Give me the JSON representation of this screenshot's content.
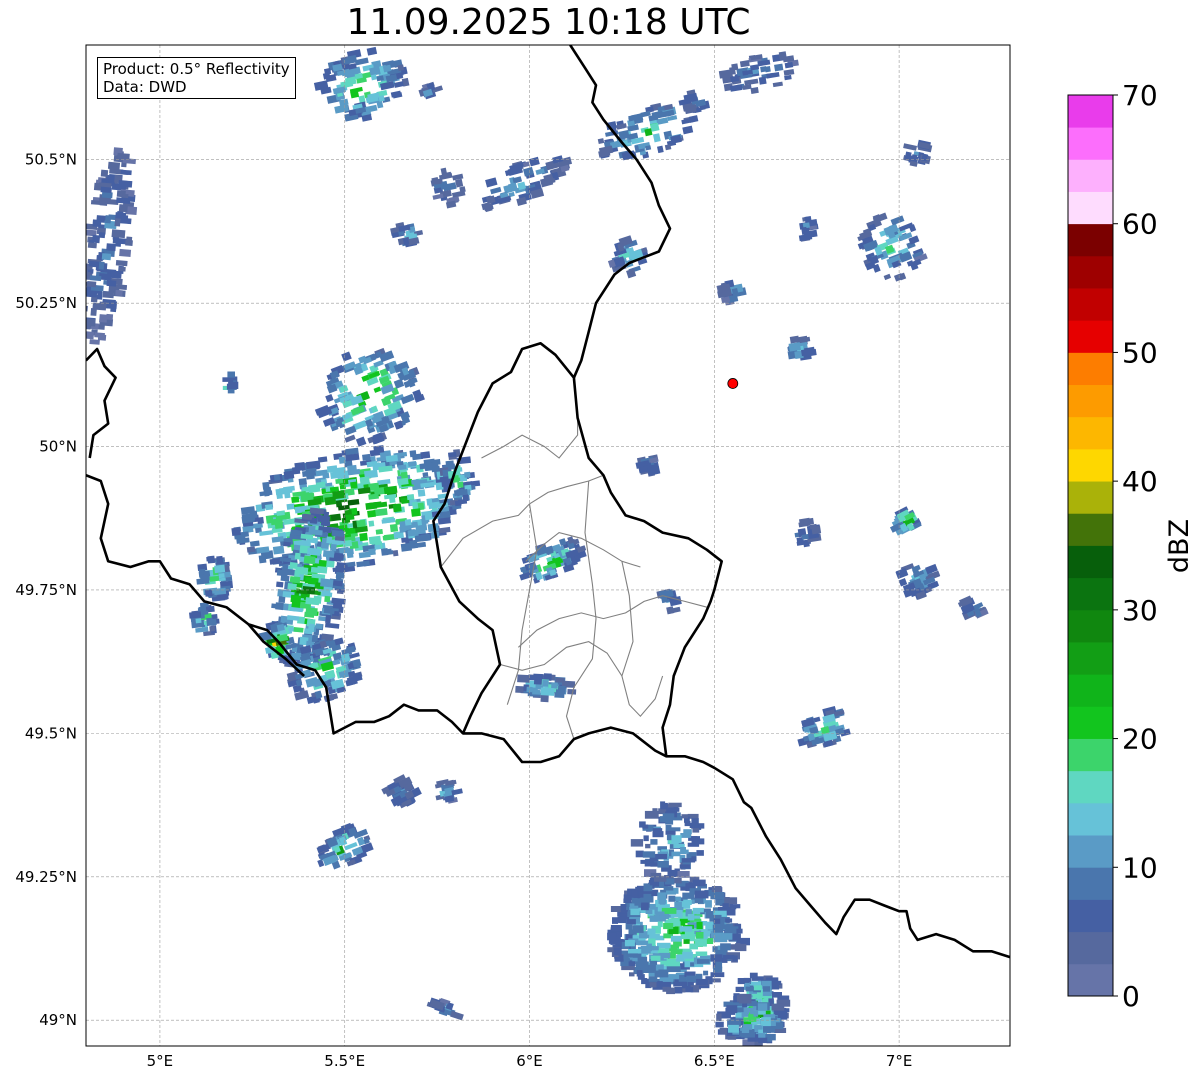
{
  "title": "11.09.2025 10:18 UTC",
  "infobox": {
    "product": "Product: 0.5° Reflectivity",
    "data": "Data: DWD"
  },
  "map_extent": {
    "lon_min": 4.8,
    "lon_max": 7.3,
    "lat_min": 48.955,
    "lat_max": 50.7
  },
  "lon_ticks": [
    {
      "v": 5.0,
      "label": "5°E"
    },
    {
      "v": 5.5,
      "label": "5.5°E"
    },
    {
      "v": 6.0,
      "label": "6°E"
    },
    {
      "v": 6.5,
      "label": "6.5°E"
    },
    {
      "v": 7.0,
      "label": "7°E"
    }
  ],
  "lat_ticks": [
    {
      "v": 50.5,
      "label": "50.5°N"
    },
    {
      "v": 50.25,
      "label": "50.25°N"
    },
    {
      "v": 50.0,
      "label": "50°N"
    },
    {
      "v": 49.75,
      "label": "49.75°N"
    },
    {
      "v": 49.5,
      "label": "49.5°N"
    },
    {
      "v": 49.25,
      "label": "49.25°N"
    },
    {
      "v": 49.0,
      "label": "49°N"
    }
  ],
  "marker": {
    "lon": 6.55,
    "lat": 50.11,
    "color": "#ff0000"
  },
  "colorbar": {
    "label": "dBZ",
    "min": 0,
    "max": 70,
    "step": 2.5,
    "tick_labels": [
      "0",
      "10",
      "20",
      "30",
      "40",
      "50",
      "60",
      "70"
    ],
    "colors": [
      "#6674a8",
      "#56699e",
      "#4560a3",
      "#4a76ad",
      "#5a9bc6",
      "#66c2d8",
      "#5fd7c1",
      "#3cd46b",
      "#12c51e",
      "#10b41a",
      "#129e15",
      "#10870f",
      "#0b7410",
      "#075f0b",
      "#437309",
      "#aab209",
      "#fed700",
      "#fdb700",
      "#fd9b00",
      "#fd7d00",
      "#e60000",
      "#c10000",
      "#9e0000",
      "#7b0000",
      "#fedcfe",
      "#fdb0fd",
      "#fc6efc",
      "#e93ceb"
    ]
  },
  "borders": {
    "national": [
      [
        [
          4.8,
          50.15
        ],
        [
          4.83,
          50.17
        ],
        [
          4.85,
          50.14
        ],
        [
          4.88,
          50.12
        ],
        [
          4.85,
          50.08
        ],
        [
          4.86,
          50.04
        ],
        [
          4.82,
          50.02
        ],
        [
          4.81,
          49.98
        ]
      ],
      [
        [
          4.8,
          49.95
        ],
        [
          4.84,
          49.94
        ],
        [
          4.86,
          49.9
        ],
        [
          4.84,
          49.84
        ],
        [
          4.86,
          49.8
        ],
        [
          4.92,
          49.79
        ],
        [
          4.97,
          49.8
        ],
        [
          5.0,
          49.8
        ],
        [
          5.03,
          49.77
        ],
        [
          5.08,
          49.76
        ],
        [
          5.12,
          49.73
        ],
        [
          5.18,
          49.72
        ],
        [
          5.24,
          49.69
        ],
        [
          5.29,
          49.68
        ],
        [
          5.32,
          49.66
        ],
        [
          5.37,
          49.62
        ],
        [
          5.42,
          49.61
        ],
        [
          5.45,
          49.58
        ],
        [
          5.47,
          49.5
        ],
        [
          5.53,
          49.52
        ],
        [
          5.58,
          49.52
        ],
        [
          5.62,
          49.53
        ],
        [
          5.66,
          49.55
        ],
        [
          5.7,
          49.54
        ],
        [
          5.75,
          49.54
        ],
        [
          5.79,
          49.52
        ],
        [
          5.82,
          49.5
        ],
        [
          5.87,
          49.5
        ],
        [
          5.93,
          49.49
        ],
        [
          5.98,
          49.45
        ],
        [
          6.03,
          49.45
        ],
        [
          6.08,
          49.46
        ],
        [
          6.12,
          49.49
        ],
        [
          6.16,
          49.5
        ],
        [
          6.22,
          49.51
        ],
        [
          6.28,
          49.5
        ],
        [
          6.34,
          49.47
        ],
        [
          6.37,
          49.46
        ],
        [
          6.42,
          49.46
        ],
        [
          6.47,
          49.45
        ],
        [
          6.5,
          49.44
        ],
        [
          6.55,
          49.42
        ],
        [
          6.58,
          49.38
        ],
        [
          6.6,
          49.37
        ],
        [
          6.64,
          49.32
        ],
        [
          6.68,
          49.28
        ],
        [
          6.72,
          49.23
        ],
        [
          6.76,
          49.2
        ],
        [
          6.8,
          49.17
        ],
        [
          6.83,
          49.15
        ],
        [
          6.85,
          49.18
        ],
        [
          6.88,
          49.21
        ],
        [
          6.92,
          49.21
        ],
        [
          6.96,
          49.2
        ],
        [
          7.0,
          49.19
        ],
        [
          7.02,
          49.19
        ],
        [
          7.03,
          49.16
        ],
        [
          7.05,
          49.14
        ],
        [
          7.1,
          49.15
        ],
        [
          7.15,
          49.14
        ],
        [
          7.2,
          49.12
        ],
        [
          7.25,
          49.12
        ],
        [
          7.3,
          49.11
        ]
      ],
      [
        [
          6.37,
          49.46
        ],
        [
          6.36,
          49.51
        ],
        [
          6.38,
          49.55
        ],
        [
          6.39,
          49.6
        ],
        [
          6.42,
          49.65
        ],
        [
          6.47,
          49.7
        ],
        [
          6.49,
          49.73
        ],
        [
          6.5,
          49.75
        ],
        [
          6.52,
          49.8
        ],
        [
          6.48,
          49.82
        ],
        [
          6.43,
          49.84
        ],
        [
          6.36,
          49.85
        ],
        [
          6.31,
          49.87
        ],
        [
          6.26,
          49.88
        ],
        [
          6.22,
          49.92
        ],
        [
          6.2,
          49.95
        ],
        [
          6.16,
          49.98
        ],
        [
          6.13,
          50.05
        ],
        [
          6.12,
          50.12
        ],
        [
          6.07,
          50.16
        ],
        [
          6.03,
          50.18
        ],
        [
          5.98,
          50.17
        ],
        [
          5.95,
          50.13
        ],
        [
          5.9,
          50.11
        ],
        [
          5.86,
          50.06
        ],
        [
          5.83,
          50.01
        ],
        [
          5.8,
          49.96
        ],
        [
          5.77,
          49.9
        ],
        [
          5.74,
          49.87
        ],
        [
          5.76,
          49.79
        ],
        [
          5.81,
          49.73
        ],
        [
          5.86,
          49.7
        ],
        [
          5.9,
          49.68
        ],
        [
          5.92,
          49.62
        ],
        [
          5.87,
          49.57
        ],
        [
          5.84,
          49.53
        ],
        [
          5.82,
          49.5
        ]
      ],
      [
        [
          5.24,
          49.69
        ],
        [
          5.28,
          49.66
        ],
        [
          5.34,
          49.63
        ],
        [
          5.39,
          49.6
        ]
      ],
      [
        [
          6.12,
          50.12
        ],
        [
          6.14,
          50.15
        ],
        [
          6.16,
          50.2
        ],
        [
          6.18,
          50.25
        ],
        [
          6.23,
          50.3
        ],
        [
          6.27,
          50.32
        ],
        [
          6.35,
          50.34
        ],
        [
          6.38,
          50.38
        ],
        [
          6.35,
          50.42
        ],
        [
          6.33,
          50.46
        ],
        [
          6.29,
          50.5
        ],
        [
          6.25,
          50.53
        ],
        [
          6.2,
          50.57
        ],
        [
          6.17,
          50.6
        ],
        [
          6.18,
          50.63
        ],
        [
          6.15,
          50.66
        ],
        [
          6.11,
          50.7
        ]
      ]
    ],
    "regional": [
      [
        [
          5.76,
          49.79
        ],
        [
          5.82,
          49.84
        ],
        [
          5.9,
          49.87
        ],
        [
          5.97,
          49.88
        ],
        [
          6.0,
          49.9
        ],
        [
          6.05,
          49.92
        ],
        [
          6.1,
          49.93
        ],
        [
          6.16,
          49.94
        ],
        [
          6.2,
          49.95
        ]
      ],
      [
        [
          5.87,
          49.98
        ],
        [
          5.93,
          50.0
        ],
        [
          5.98,
          50.02
        ],
        [
          6.04,
          50.0
        ],
        [
          6.08,
          49.98
        ],
        [
          6.13,
          50.02
        ],
        [
          6.13,
          50.05
        ]
      ],
      [
        [
          5.99,
          49.8
        ],
        [
          6.04,
          49.83
        ],
        [
          6.08,
          49.85
        ],
        [
          6.14,
          49.84
        ],
        [
          6.2,
          49.82
        ],
        [
          6.25,
          49.8
        ],
        [
          6.3,
          49.79
        ]
      ],
      [
        [
          5.97,
          49.65
        ],
        [
          6.02,
          49.68
        ],
        [
          6.08,
          49.7
        ],
        [
          6.14,
          49.71
        ],
        [
          6.2,
          49.7
        ],
        [
          6.26,
          49.71
        ],
        [
          6.31,
          49.73
        ],
        [
          6.36,
          49.74
        ],
        [
          6.42,
          49.73
        ],
        [
          6.48,
          49.72
        ]
      ],
      [
        [
          5.92,
          49.62
        ],
        [
          5.98,
          49.61
        ],
        [
          6.04,
          49.62
        ],
        [
          6.1,
          49.65
        ],
        [
          6.16,
          49.66
        ],
        [
          6.21,
          49.64
        ],
        [
          6.25,
          49.6
        ],
        [
          6.27,
          49.55
        ],
        [
          6.3,
          49.53
        ],
        [
          6.34,
          49.56
        ],
        [
          6.36,
          49.6
        ]
      ],
      [
        [
          6.0,
          49.9
        ],
        [
          6.02,
          49.82
        ],
        [
          6.0,
          49.75
        ],
        [
          5.98,
          49.68
        ],
        [
          5.97,
          49.61
        ],
        [
          5.94,
          49.55
        ]
      ],
      [
        [
          6.16,
          49.94
        ],
        [
          6.15,
          49.85
        ],
        [
          6.17,
          49.76
        ],
        [
          6.18,
          49.7
        ],
        [
          6.17,
          49.63
        ],
        [
          6.12,
          49.58
        ],
        [
          6.1,
          49.53
        ],
        [
          6.12,
          49.49
        ]
      ],
      [
        [
          6.25,
          49.8
        ],
        [
          6.27,
          49.74
        ],
        [
          6.28,
          49.66
        ],
        [
          6.25,
          49.6
        ]
      ]
    ]
  },
  "cells": [
    {
      "lon": 4.86,
      "lat": 50.35,
      "rx": 0.055,
      "ry": 0.17,
      "rot": 8,
      "core": 8,
      "n": 140
    },
    {
      "lon": 5.55,
      "lat": 50.63,
      "rx": 0.12,
      "ry": 0.06,
      "rot": -20,
      "core": 22,
      "n": 90
    },
    {
      "lon": 6.98,
      "lat": 50.35,
      "rx": 0.08,
      "ry": 0.06,
      "rot": -35,
      "core": 18,
      "n": 60
    },
    {
      "lon": 6.32,
      "lat": 50.55,
      "rx": 0.14,
      "ry": 0.04,
      "rot": -20,
      "core": 20,
      "n": 70
    },
    {
      "lon": 6.62,
      "lat": 50.65,
      "rx": 0.1,
      "ry": 0.03,
      "rot": -15,
      "core": 10,
      "n": 40
    },
    {
      "lon": 5.98,
      "lat": 50.46,
      "rx": 0.13,
      "ry": 0.03,
      "rot": -25,
      "core": 14,
      "n": 50
    },
    {
      "lon": 5.78,
      "lat": 50.45,
      "rx": 0.04,
      "ry": 0.03,
      "rot": -20,
      "core": 8,
      "n": 20
    },
    {
      "lon": 5.57,
      "lat": 50.09,
      "rx": 0.14,
      "ry": 0.08,
      "rot": -35,
      "core": 26,
      "n": 120
    },
    {
      "lon": 5.52,
      "lat": 49.89,
      "rx": 0.32,
      "ry": 0.1,
      "rot": -12,
      "core": 34,
      "n": 420
    },
    {
      "lon": 5.4,
      "lat": 49.75,
      "rx": 0.09,
      "ry": 0.14,
      "rot": 10,
      "core": 28,
      "n": 220
    },
    {
      "lon": 5.45,
      "lat": 49.61,
      "rx": 0.1,
      "ry": 0.05,
      "rot": -25,
      "core": 22,
      "n": 90
    },
    {
      "lon": 5.32,
      "lat": 49.66,
      "rx": 0.04,
      "ry": 0.03,
      "rot": -20,
      "core": 38,
      "n": 40
    },
    {
      "lon": 5.15,
      "lat": 49.77,
      "rx": 0.04,
      "ry": 0.04,
      "rot": -10,
      "core": 22,
      "n": 40
    },
    {
      "lon": 5.12,
      "lat": 49.7,
      "rx": 0.03,
      "ry": 0.03,
      "rot": -10,
      "core": 18,
      "n": 25
    },
    {
      "lon": 5.81,
      "lat": 49.94,
      "rx": 0.04,
      "ry": 0.05,
      "rot": -10,
      "core": 20,
      "n": 40
    },
    {
      "lon": 6.06,
      "lat": 49.8,
      "rx": 0.09,
      "ry": 0.03,
      "rot": -30,
      "core": 22,
      "n": 60
    },
    {
      "lon": 6.38,
      "lat": 49.31,
      "rx": 0.09,
      "ry": 0.07,
      "rot": 0,
      "core": 14,
      "n": 90
    },
    {
      "lon": 6.4,
      "lat": 49.15,
      "rx": 0.18,
      "ry": 0.1,
      "rot": 0,
      "core": 24,
      "n": 420
    },
    {
      "lon": 6.62,
      "lat": 49.02,
      "rx": 0.07,
      "ry": 0.06,
      "rot": 0,
      "core": 26,
      "n": 120
    },
    {
      "lon": 6.6,
      "lat": 49.0,
      "rx": 0.09,
      "ry": 0.04,
      "rot": 0,
      "core": 20,
      "n": 80
    },
    {
      "lon": 5.5,
      "lat": 49.3,
      "rx": 0.08,
      "ry": 0.03,
      "rot": -35,
      "core": 24,
      "n": 50
    },
    {
      "lon": 5.65,
      "lat": 49.4,
      "rx": 0.03,
      "ry": 0.03,
      "rot": -45,
      "core": 12,
      "n": 25
    },
    {
      "lon": 5.78,
      "lat": 49.4,
      "rx": 0.03,
      "ry": 0.02,
      "rot": -20,
      "core": 12,
      "n": 15
    },
    {
      "lon": 6.04,
      "lat": 49.58,
      "rx": 0.08,
      "ry": 0.02,
      "rot": 5,
      "core": 18,
      "n": 40
    },
    {
      "lon": 6.8,
      "lat": 49.51,
      "rx": 0.07,
      "ry": 0.03,
      "rot": -25,
      "core": 20,
      "n": 40
    },
    {
      "lon": 7.05,
      "lat": 49.77,
      "rx": 0.05,
      "ry": 0.03,
      "rot": -35,
      "core": 18,
      "n": 35
    },
    {
      "lon": 7.02,
      "lat": 49.87,
      "rx": 0.03,
      "ry": 0.02,
      "rot": -45,
      "core": 30,
      "n": 20
    },
    {
      "lon": 6.73,
      "lat": 50.17,
      "rx": 0.03,
      "ry": 0.02,
      "rot": -15,
      "core": 14,
      "n": 20
    },
    {
      "lon": 6.75,
      "lat": 49.85,
      "rx": 0.03,
      "ry": 0.02,
      "rot": -15,
      "core": 12,
      "n": 15
    },
    {
      "lon": 6.75,
      "lat": 50.38,
      "rx": 0.02,
      "ry": 0.02,
      "rot": -15,
      "core": 10,
      "n": 15
    },
    {
      "lon": 6.55,
      "lat": 50.27,
      "rx": 0.03,
      "ry": 0.02,
      "rot": -20,
      "core": 12,
      "n": 20
    },
    {
      "lon": 6.32,
      "lat": 49.97,
      "rx": 0.02,
      "ry": 0.02,
      "rot": -20,
      "core": 10,
      "n": 15
    },
    {
      "lon": 6.38,
      "lat": 49.73,
      "rx": 0.02,
      "ry": 0.02,
      "rot": -20,
      "core": 10,
      "n": 12
    },
    {
      "lon": 6.27,
      "lat": 50.33,
      "rx": 0.04,
      "ry": 0.03,
      "rot": -30,
      "core": 20,
      "n": 25
    },
    {
      "lon": 5.73,
      "lat": 50.62,
      "rx": 0.02,
      "ry": 0.01,
      "rot": -30,
      "core": 10,
      "n": 10
    },
    {
      "lon": 5.19,
      "lat": 50.11,
      "rx": 0.01,
      "ry": 0.02,
      "rot": 0,
      "core": 18,
      "n": 8
    },
    {
      "lon": 5.77,
      "lat": 49.02,
      "rx": 0.04,
      "ry": 0.01,
      "rot": 30,
      "core": 12,
      "n": 15
    },
    {
      "lon": 7.2,
      "lat": 49.72,
      "rx": 0.02,
      "ry": 0.02,
      "rot": -40,
      "core": 12,
      "n": 15
    },
    {
      "lon": 7.05,
      "lat": 50.51,
      "rx": 0.03,
      "ry": 0.02,
      "rot": 20,
      "core": 12,
      "n": 15
    },
    {
      "lon": 6.45,
      "lat": 50.6,
      "rx": 0.03,
      "ry": 0.02,
      "rot": -20,
      "core": 10,
      "n": 15
    },
    {
      "lon": 5.67,
      "lat": 50.37,
      "rx": 0.03,
      "ry": 0.02,
      "rot": -20,
      "core": 16,
      "n": 15
    }
  ]
}
